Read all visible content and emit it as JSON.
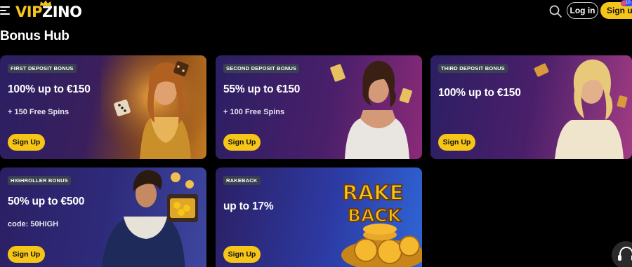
{
  "header": {
    "logo_part1": "VIP",
    "logo_part2": "ZINO",
    "login_label": "Log in",
    "signup_label": "Sign up",
    "notification_count": "10"
  },
  "page": {
    "title": "Bonus Hub"
  },
  "cards": [
    {
      "badge": "FIRST DEPOSIT BONUS",
      "amount": "100% up to €150",
      "sub": "+ 150 Free Spins",
      "cta": "Sign Up"
    },
    {
      "badge": "SECOND DEPOSIT BONUS",
      "amount": "55% up to €150",
      "sub": "+ 100 Free Spins",
      "cta": "Sign Up"
    },
    {
      "badge": "THIRD DEPOSIT BONUS",
      "amount": "100% up to €150",
      "cta": "Sign Up"
    },
    {
      "badge": "HIGHROLLER BONUS",
      "amount": "50% up to €500",
      "sub": "code: 50HIGH",
      "cta": "Sign Up"
    },
    {
      "badge": "RAKEBACK",
      "amount": "up to 17%",
      "art_text_1": "RAKE",
      "art_text_2": "BACK",
      "cta": "Sign Up"
    }
  ],
  "colors": {
    "accent": "#f5c518",
    "background": "#000000",
    "card_dark": "#2b1f63"
  },
  "icons": [
    "menu-icon",
    "crown-icon",
    "search-icon",
    "support-headset-icon"
  ]
}
